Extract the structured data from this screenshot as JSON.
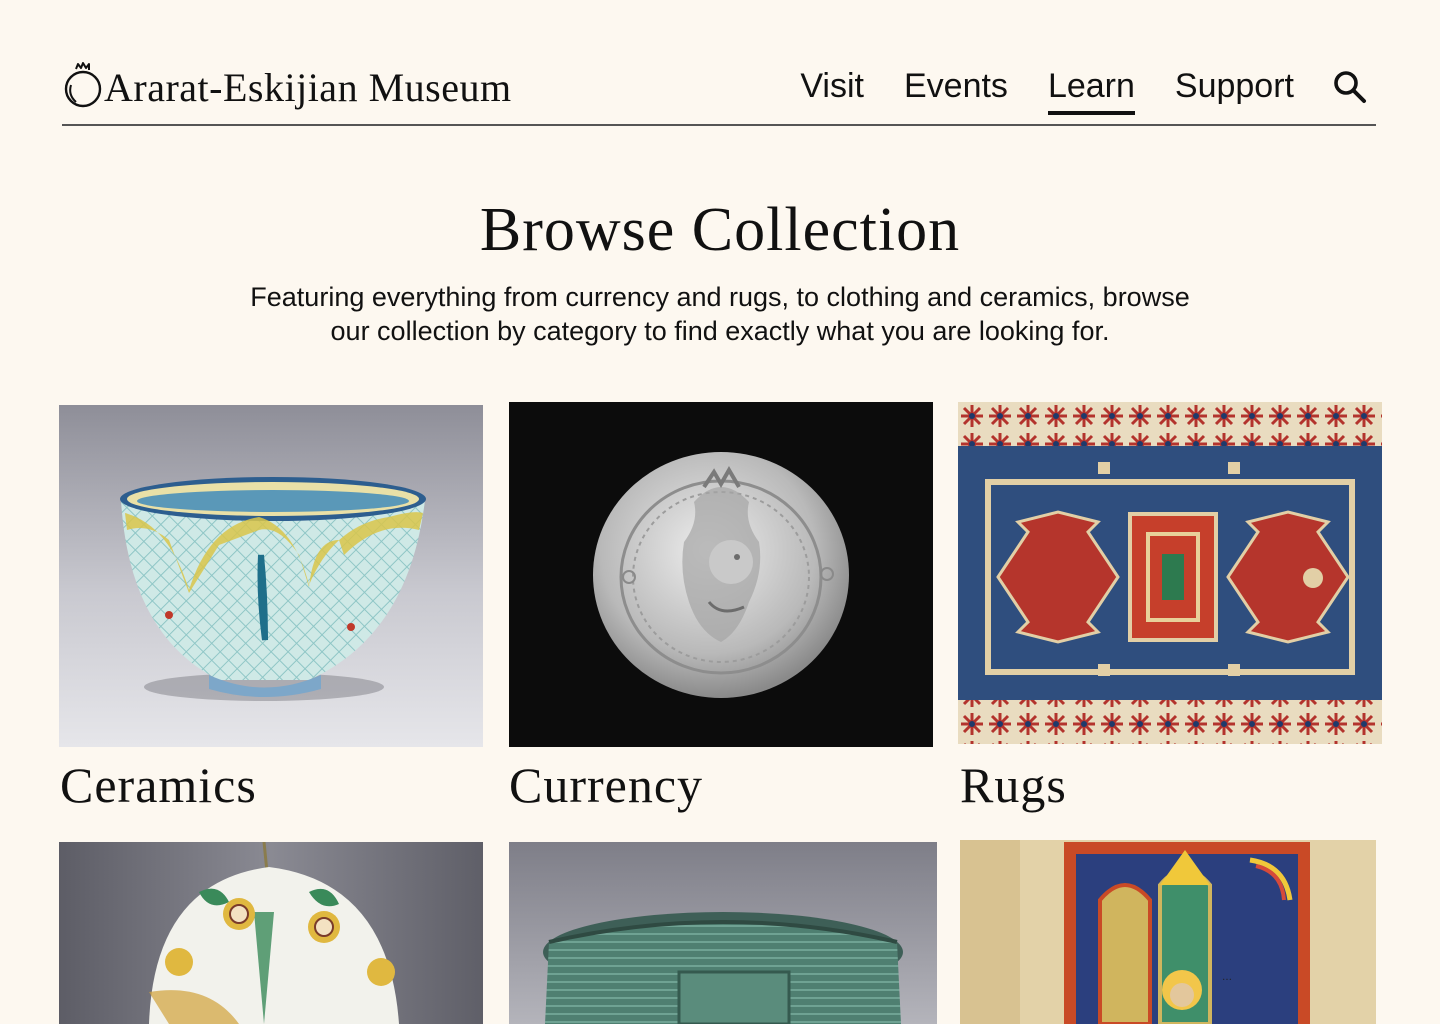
{
  "brand": {
    "name": "Ararat-Eskijian Museum",
    "logo_icon": "pomegranate-icon"
  },
  "nav": {
    "items": [
      {
        "label": "Visit",
        "active": false
      },
      {
        "label": "Events",
        "active": false
      },
      {
        "label": "Learn",
        "active": true
      },
      {
        "label": "Support",
        "active": false
      }
    ],
    "search_icon": "search-icon"
  },
  "main": {
    "title": "Browse Collection",
    "intro_line1": "Featuring everything from currency and rugs, to clothing and ceramics, browse",
    "intro_line2": "our collection by category to find exactly what you are looking for."
  },
  "categories": [
    {
      "label": "Ceramics",
      "image": "glazed-ceramic-bowl-image"
    },
    {
      "label": "Currency",
      "image": "silver-coin-image"
    },
    {
      "label": "Rugs",
      "image": "red-blue-rug-image"
    },
    {
      "label": "",
      "image": "ceramic-egg-ornament-image"
    },
    {
      "label": "",
      "image": "bronze-belt-image"
    },
    {
      "label": "",
      "image": "illuminated-manuscript-image"
    }
  ],
  "colors": {
    "background": "#fdf8f0",
    "text": "#111111",
    "rule": "#555555"
  }
}
